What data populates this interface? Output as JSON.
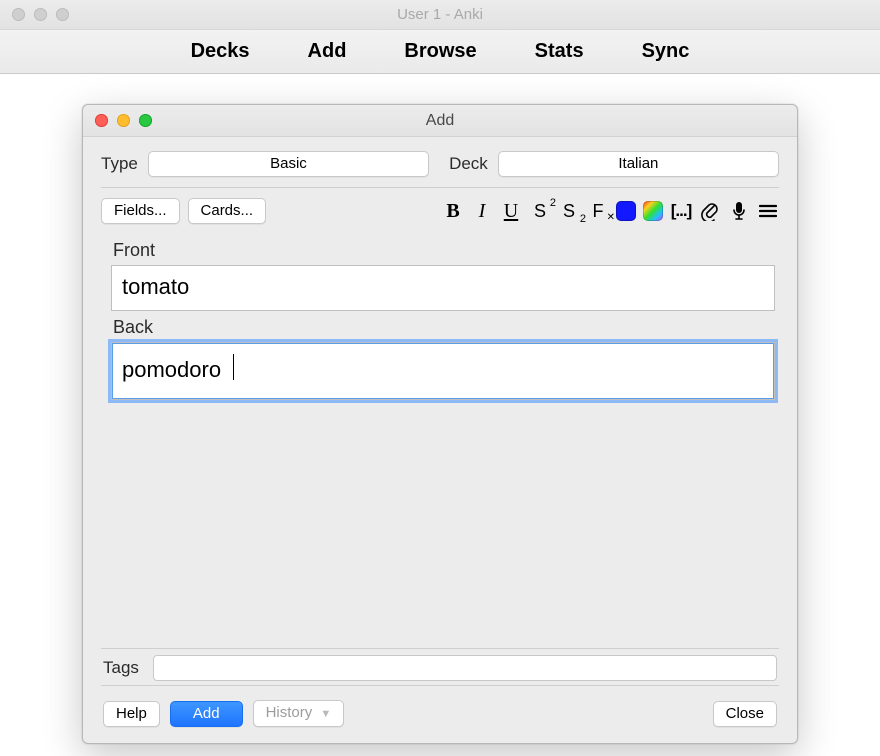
{
  "app": {
    "title": "User 1 - Anki",
    "nav": [
      "Decks",
      "Add",
      "Browse",
      "Stats",
      "Sync"
    ]
  },
  "dialog": {
    "title": "Add",
    "type_label": "Type",
    "type_value": "Basic",
    "deck_label": "Deck",
    "deck_value": "Italian",
    "fields_button": "Fields...",
    "cards_button": "Cards...",
    "front_label": "Front",
    "front_value": "tomato",
    "back_label": "Back",
    "back_value": "pomodoro",
    "tags_label": "Tags",
    "tags_value": "",
    "help_button": "Help",
    "add_button": "Add",
    "history_button": "History",
    "close_button": "Close"
  },
  "icons": {
    "bold": "B",
    "italic": "I",
    "underline": "U",
    "superscript": "S",
    "subscript": "S",
    "clear_format": "F",
    "cloze": "[...]"
  }
}
